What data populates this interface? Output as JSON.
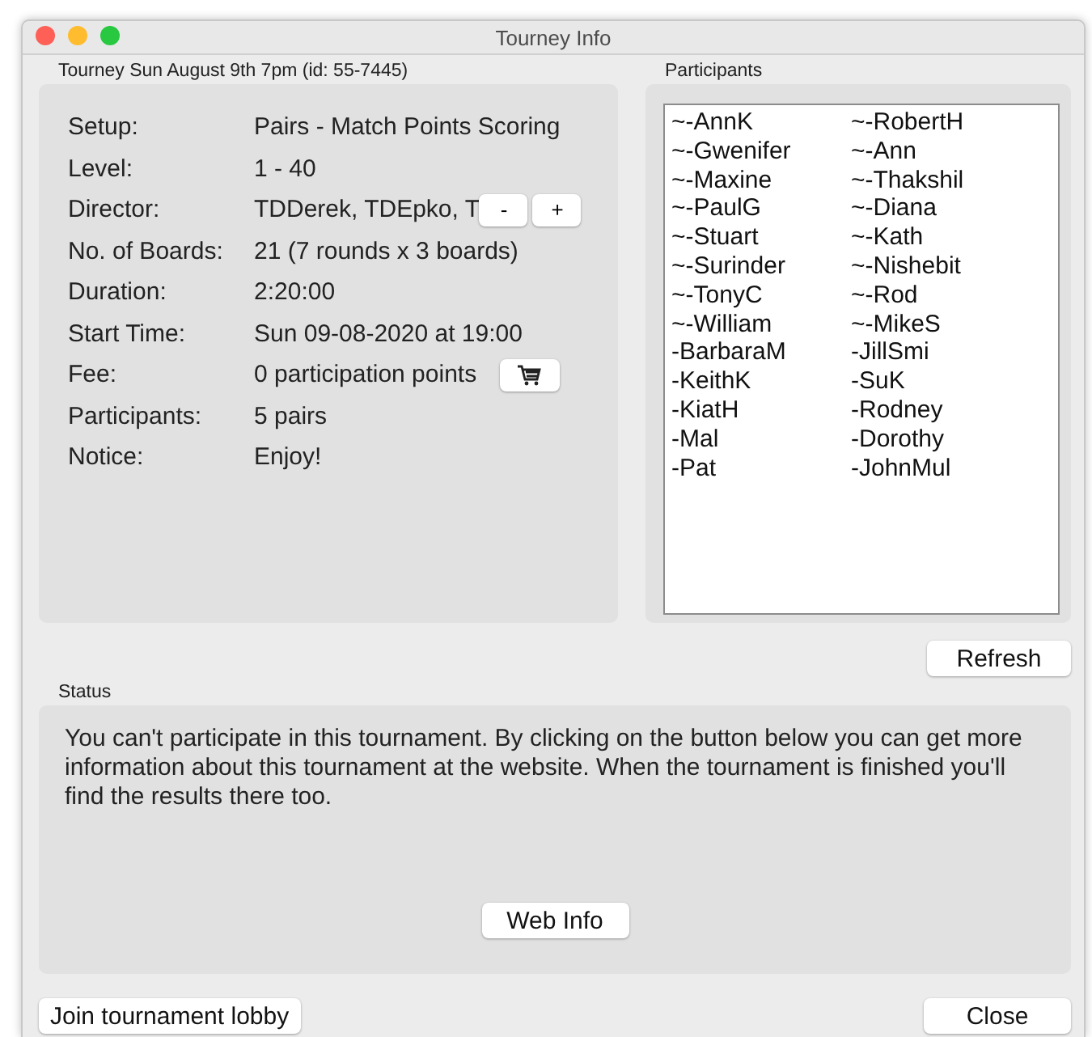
{
  "window": {
    "title": "Tourney Info"
  },
  "info": {
    "title": "Tourney Sun August 9th 7pm (id: 55-7445)",
    "rows": [
      {
        "label": "Setup:",
        "value": "Pairs - Match Points Scoring"
      },
      {
        "label": "Level:",
        "value": "1 - 40"
      },
      {
        "label": "Director:",
        "value": "TDDerek, TDEpko, T",
        "kind": "director",
        "buttons": [
          "-",
          "+"
        ]
      },
      {
        "label": "No. of Boards:",
        "value": "21 (7 rounds x 3 boards)"
      },
      {
        "label": "Duration:",
        "value": "2:20:00"
      },
      {
        "label": "Start Time:",
        "value": "Sun 09-08-2020 at 19:00"
      },
      {
        "label": "Fee:",
        "value": "0 participation points",
        "kind": "fee"
      },
      {
        "label": "Participants:",
        "value": "5 pairs"
      },
      {
        "label": "Notice:",
        "value": "Enjoy!"
      }
    ]
  },
  "participants": {
    "title": "Participants",
    "columns": [
      [
        "~-AnnK",
        "~-Gwenifer",
        "~-Maxine",
        "~-PaulG",
        "~-Stuart",
        "~-Surinder",
        "~-TonyC",
        "~-William",
        "-BarbaraM",
        "-KeithK",
        "-KiatH",
        "-Mal",
        "-Pat"
      ],
      [
        "~-RobertH",
        "~-Ann",
        "~-Thakshil",
        "~-Diana",
        "~-Kath",
        "~-Nishebit",
        "~-Rod",
        "~-MikeS",
        "-JillSmi",
        "-SuK",
        "-Rodney",
        "-Dorothy",
        "-JohnMul"
      ]
    ],
    "refresh": "Refresh"
  },
  "status": {
    "title": "Status",
    "message": "You can't participate in this tournament. By clicking on the button below you can get more information about this tournament at the website. When the tournament is finished you'll find the results there too.",
    "button": "Web Info"
  },
  "footer": {
    "left": "Join tournament lobby",
    "right": "Close"
  }
}
